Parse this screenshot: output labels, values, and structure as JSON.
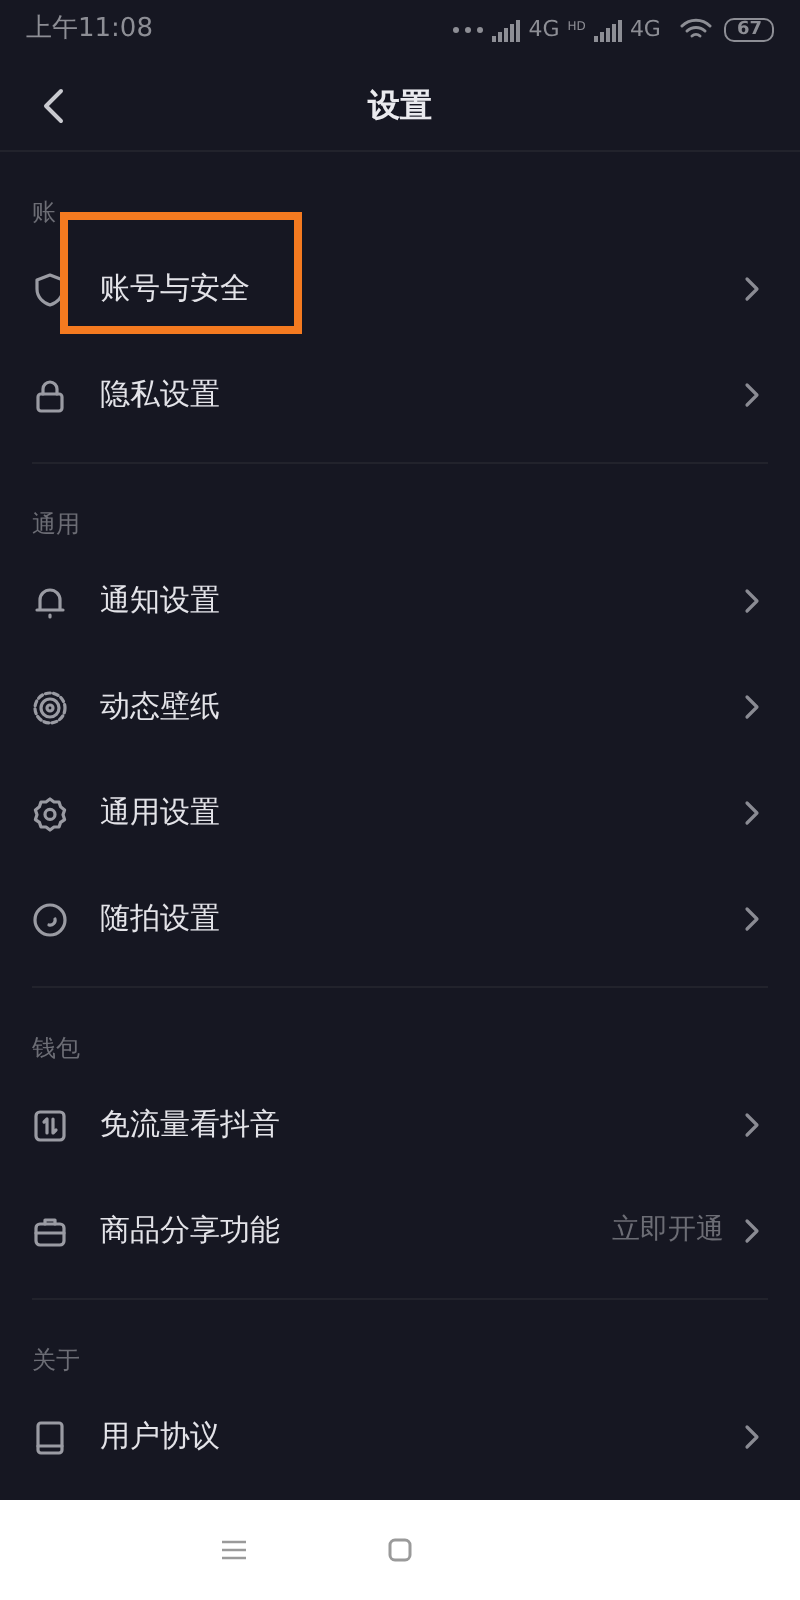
{
  "status_bar": {
    "time": "上午11:08",
    "network_1": "4G",
    "hd": "HD",
    "network_2": "4G",
    "battery": "67"
  },
  "header": {
    "title": "设置"
  },
  "sections": [
    {
      "label": "账",
      "items": [
        {
          "label": "账号与安全"
        },
        {
          "label": "隐私设置"
        }
      ]
    },
    {
      "label": "通用",
      "items": [
        {
          "label": "通知设置"
        },
        {
          "label": "动态壁纸"
        },
        {
          "label": "通用设置"
        },
        {
          "label": "随拍设置"
        }
      ]
    },
    {
      "label": "钱包",
      "items": [
        {
          "label": "免流量看抖音"
        },
        {
          "label": "商品分享功能",
          "value": "立即开通"
        }
      ]
    },
    {
      "label": "关于",
      "items": [
        {
          "label": "用户协议"
        }
      ]
    }
  ]
}
